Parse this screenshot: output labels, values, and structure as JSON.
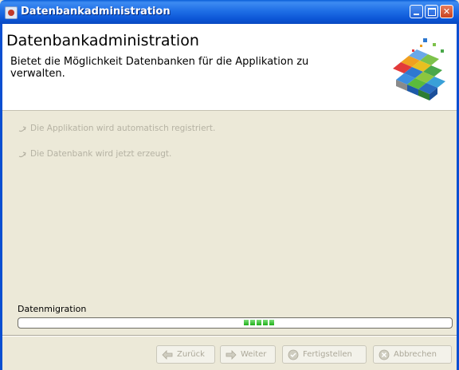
{
  "window": {
    "title": "Datenbankadministration"
  },
  "header": {
    "title": "Datenbankadministration",
    "description": "Bietet die Möglichkeit Datenbanken für die Applikation zu verwalten."
  },
  "steps": [
    {
      "label": "Die Applikation wird automatisch registriert.",
      "icon": "step-arrow-icon"
    },
    {
      "label": "Die Datenbank wird jetzt erzeugt.",
      "icon": "step-arrow-icon"
    }
  ],
  "progress": {
    "label": "Datenmigration",
    "state": "indeterminate",
    "blocks": 5
  },
  "buttons": {
    "back": "Zurück",
    "next": "Weiter",
    "finish": "Fertigstellen",
    "cancel": "Abbrechen"
  },
  "colors": {
    "titlebar": "#0b55d6",
    "background": "#ece9d8",
    "disabled_text": "#aca899",
    "progress_fill": "#1fae1a"
  }
}
